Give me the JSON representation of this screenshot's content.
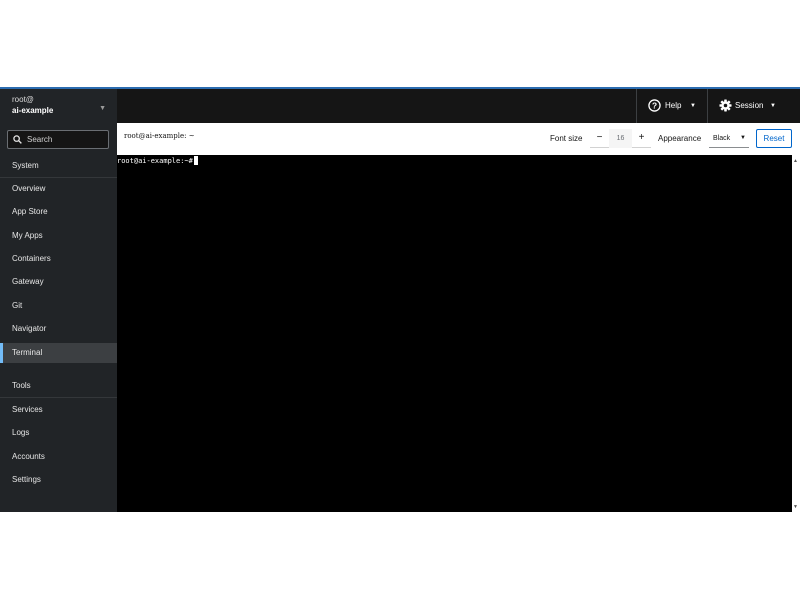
{
  "host": {
    "user": "root@",
    "name": "ai-example"
  },
  "sidebar": {
    "search_placeholder": "Search",
    "items": [
      {
        "label": "System"
      },
      {
        "label": "Overview"
      },
      {
        "label": "App Store"
      },
      {
        "label": "My Apps"
      },
      {
        "label": "Containers"
      },
      {
        "label": "Gateway"
      },
      {
        "label": "Git"
      },
      {
        "label": "Navigator"
      },
      {
        "label": "Terminal",
        "active": true
      },
      {
        "label": "Tools"
      },
      {
        "label": "Services"
      },
      {
        "label": "Logs"
      },
      {
        "label": "Accounts"
      },
      {
        "label": "Settings"
      }
    ]
  },
  "masthead": {
    "help_label": "Help",
    "session_label": "Session"
  },
  "toolbar": {
    "title": "root@ai-example: ~",
    "font_size_label": "Font size",
    "font_size_value": "16",
    "minus": "−",
    "plus": "+",
    "appearance_label": "Appearance",
    "appearance_value": "Black",
    "reset_label": "Reset"
  },
  "terminal": {
    "prompt": "root@ai-example:~#"
  },
  "colors": {
    "accent": "#73bcf7",
    "link": "#0066cc",
    "masthead": "#151515",
    "sidebar": "#212427"
  }
}
